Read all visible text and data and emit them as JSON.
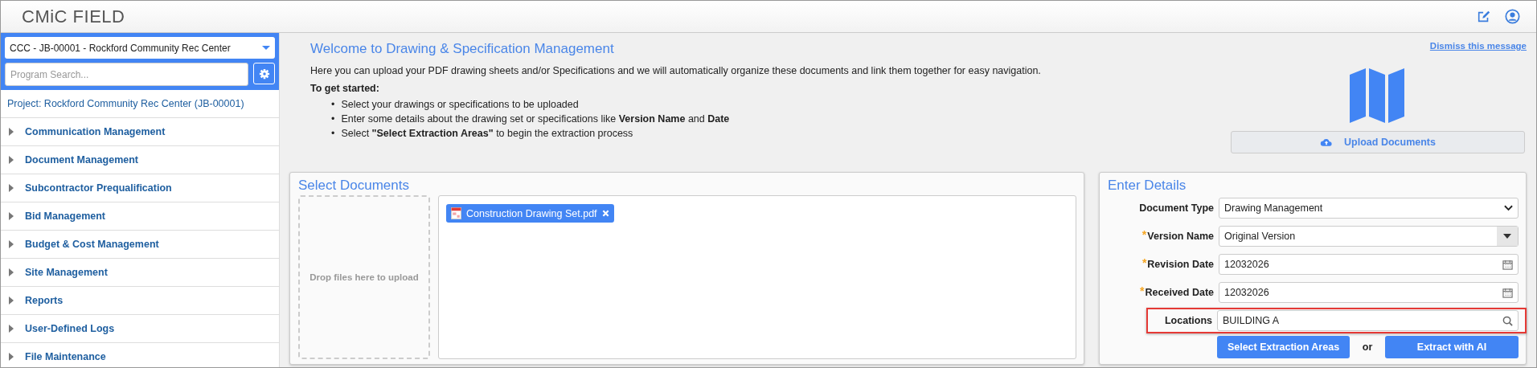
{
  "header": {
    "logo": "CMiC FIELD"
  },
  "sidebar": {
    "project_select": "CCC - JB-00001 - Rockford Community Rec Center",
    "search": {
      "placeholder": "Program Search..."
    },
    "project_label": "Project: Rockford Community Rec Center (JB-00001)",
    "items": [
      {
        "label": "Communication Management",
        "expanded": false
      },
      {
        "label": "Document Management",
        "expanded": false
      },
      {
        "label": "Subcontractor Prequalification",
        "expanded": false
      },
      {
        "label": "Bid Management",
        "expanded": false
      },
      {
        "label": "Budget & Cost Management",
        "expanded": false
      },
      {
        "label": "Site Management",
        "expanded": false
      },
      {
        "label": "Reports",
        "expanded": false
      },
      {
        "label": "User-Defined Logs",
        "expanded": false
      },
      {
        "label": "File Maintenance",
        "expanded": false
      }
    ]
  },
  "welcome": {
    "title": "Welcome to Drawing & Specification Management",
    "dismiss": "Dismiss this message",
    "intro": "Here you can upload your PDF drawing sheets and/or Specifications and we will automatically organize these documents and link them together for easy navigation.",
    "subheading": "To get started:",
    "steps": [
      {
        "bullet": "•",
        "text": "Select your drawings or specifications to be uploaded"
      },
      {
        "bullet": "•",
        "text": "Enter some details about the drawing set or specifications like **Version Name** and **Date**"
      },
      {
        "bullet": "•",
        "text": "Select **\"Select Extraction Areas\"** to begin the extraction process"
      }
    ],
    "upload_button": "Upload Documents"
  },
  "select_documents": {
    "title": "Select Documents",
    "dropzone": "Drop files here to upload",
    "files": [
      "Construction Drawing Set.pdf"
    ]
  },
  "enter_details": {
    "title": "Enter Details",
    "fields": [
      {
        "kind": "select",
        "label": "Document Type",
        "value": "Drawing Management",
        "highlighted": false
      },
      {
        "kind": "combo",
        "label": "Version Name",
        "required_mark": "*",
        "value": "Original Version",
        "highlighted": false
      },
      {
        "kind": "date",
        "label": "Revision Date",
        "required_mark": "*",
        "value": "12032026",
        "highlighted": false
      },
      {
        "kind": "date",
        "label": "Received Date",
        "required_mark": "*",
        "value": "12032026",
        "highlighted": false
      },
      {
        "kind": "search",
        "label": "Locations",
        "value": "BUILDING A",
        "highlighted": true
      }
    ],
    "primary_button": "Select Extraction Areas",
    "separator": "or",
    "secondary_button": "Extract with AI"
  }
}
